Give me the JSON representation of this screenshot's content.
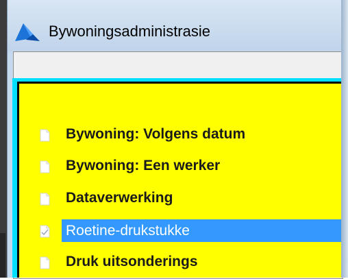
{
  "window": {
    "title": "Bywoningsadministrasie",
    "icon": "app-triangle-logo-icon"
  },
  "menu": {
    "items": [
      {
        "label": "Bywoning: Volgens datum",
        "icon": "page-icon",
        "selected": false
      },
      {
        "label": "Bywoning: Een werker",
        "icon": "page-icon",
        "selected": false
      },
      {
        "label": "Dataverwerking",
        "icon": "page-icon",
        "selected": false
      },
      {
        "label": "Roetine-drukstukke",
        "icon": "page-check-icon",
        "selected": true
      },
      {
        "label": "Druk uitsonderings",
        "icon": "page-icon",
        "selected": false
      }
    ]
  },
  "colors": {
    "panel_background": "#ffff00",
    "panel_border": "#00dfff",
    "selection": "#3399ff",
    "titlebar": "#c9dbee"
  }
}
